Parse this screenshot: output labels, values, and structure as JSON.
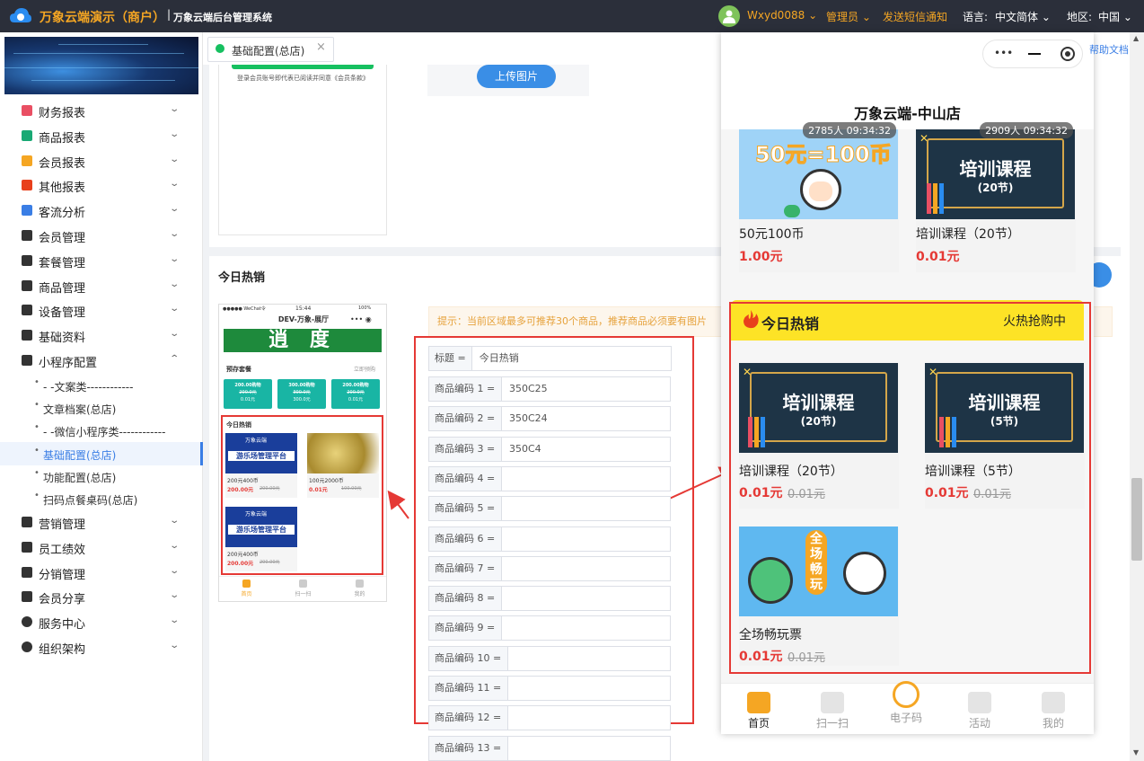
{
  "header": {
    "brand": "万象云端演示（商户）",
    "separator": "|",
    "system_title": "万象云端后台管理系统",
    "username": "Wxyd0088",
    "role": "管理员",
    "sms": "发送短信通知",
    "lang_label": "语言:",
    "lang_value": "中文简体",
    "region_label": "地区:",
    "region_value": "中国",
    "colors": {
      "brand": "#f5a623",
      "bg": "#2b2f3a"
    }
  },
  "sidebar": {
    "items": [
      {
        "label": "财务报表",
        "icon": "finance-report-icon"
      },
      {
        "label": "商品报表",
        "icon": "goods-report-icon"
      },
      {
        "label": "会员报表",
        "icon": "member-report-icon"
      },
      {
        "label": "其他报表",
        "icon": "other-report-icon"
      },
      {
        "label": "客流分析",
        "icon": "traffic-icon"
      },
      {
        "label": "会员管理",
        "icon": "member-icon"
      },
      {
        "label": "套餐管理",
        "icon": "package-icon"
      },
      {
        "label": "商品管理",
        "icon": "goods-icon"
      },
      {
        "label": "设备管理",
        "icon": "device-icon"
      },
      {
        "label": "基础资料",
        "icon": "doc-icon"
      },
      {
        "label": "小程序配置",
        "icon": "gear-icon"
      }
    ],
    "sub_items": [
      "- -文案类------------",
      "文章档案(总店)",
      "- -微信小程序类------------",
      "基础配置(总店)",
      "功能配置(总店)",
      "扫码点餐桌码(总店)"
    ],
    "items_after": [
      {
        "label": "营销管理",
        "icon": "marketing-icon"
      },
      {
        "label": "员工绩效",
        "icon": "staff-icon"
      },
      {
        "label": "分销管理",
        "icon": "distribution-icon"
      },
      {
        "label": "会员分享",
        "icon": "share-icon"
      },
      {
        "label": "服务中心",
        "icon": "service-icon"
      },
      {
        "label": "组织架构",
        "icon": "org-icon"
      }
    ]
  },
  "tab": {
    "label": "基础配置(总店)",
    "close": "×"
  },
  "upper": {
    "agreement": "登录会员账号即代表已阅读并同意《会员条款》",
    "upload_button": "上传图片"
  },
  "hot_section": {
    "title": "今日热销",
    "tip": "提示：当前区域最多可推荐30个商品，推荐商品必须要有图片"
  },
  "form": {
    "title_label": "标题 =",
    "title_value": "今日热销",
    "rows": [
      {
        "label": "商品编码 1 =",
        "value": "350C25"
      },
      {
        "label": "商品编码 2 =",
        "value": "350C24"
      },
      {
        "label": "商品编码 3 =",
        "value": "350C4"
      },
      {
        "label": "商品编码 4 =",
        "value": ""
      },
      {
        "label": "商品编码 5 =",
        "value": ""
      },
      {
        "label": "商品编码 6 =",
        "value": ""
      },
      {
        "label": "商品编码 7 =",
        "value": ""
      },
      {
        "label": "商品编码 8 =",
        "value": ""
      },
      {
        "label": "商品编码 9 =",
        "value": ""
      },
      {
        "label": "商品编码 10 =",
        "value": ""
      },
      {
        "label": "商品编码 11 =",
        "value": ""
      },
      {
        "label": "商品编码 12 =",
        "value": ""
      },
      {
        "label": "商品编码 13 =",
        "value": ""
      }
    ]
  },
  "mini_phone": {
    "status_left": "●●●●● WeChat令",
    "status_time": "15:44",
    "status_right": "100%",
    "title": "DEV-万象-展厅",
    "banner_text": "逍 度",
    "preset_label": "预存套餐",
    "preset_more": "立即预购",
    "packages": [
      {
        "name": "200.00购物",
        "old": "200.0元",
        "price": "0.01元"
      },
      {
        "name": "300.00购物",
        "old": "300.0元",
        "price": "300.0元"
      },
      {
        "name": "200.00购物",
        "old": "200.0元",
        "price": "0.01元"
      }
    ],
    "hot_label": "今日热销",
    "products": [
      {
        "logo": "万象云端",
        "slogan": "游乐场管理平台",
        "name": "200元400币",
        "price": "200.00元",
        "old": "200.00元"
      },
      {
        "logo": "",
        "slogan": "",
        "name": "100元2000币",
        "price": "0.01元",
        "old": "100.00元"
      },
      {
        "logo": "万象云端",
        "slogan": "游乐场管理平台",
        "name": "200元400币",
        "price": "200.00元",
        "old": "200.00元"
      }
    ],
    "nav": [
      "首页",
      "扫一扫",
      "我的"
    ]
  },
  "preview": {
    "store": "万象云端-中山店",
    "help": "帮助文档",
    "top_products": [
      {
        "badge": "2785人 09:34:32",
        "name": "50元100币",
        "price": "1.00元",
        "img_text": "50元=100币"
      },
      {
        "badge": "2909人 09:34:32",
        "name": "培训课程（20节）",
        "price": "0.01元",
        "img_text": "培训课程",
        "img_sub": "(20节)"
      }
    ],
    "hot_title": "今日热销",
    "hot_sub": "火热抢购中",
    "hot_products": [
      {
        "name": "培训课程（20节）",
        "price": "0.01元",
        "old": "0.01元",
        "img_text": "培训课程",
        "img_sub": "(20节)"
      },
      {
        "name": "培训课程（5节）",
        "price": "0.01元",
        "old": "0.01元",
        "img_text": "培训课程",
        "img_sub": "(5节)"
      },
      {
        "name": "全场畅玩票",
        "price": "0.01元",
        "old": "0.01元",
        "img_text": "全场畅玩"
      }
    ],
    "bottom_nav": [
      "首页",
      "扫一扫",
      "电子码",
      "活动",
      "我的"
    ],
    "colors": {
      "hot_bar": "#fde326",
      "price": "#e53935",
      "highlight": "#e53935"
    }
  }
}
